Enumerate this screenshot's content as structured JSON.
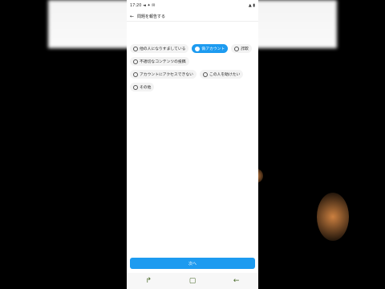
{
  "status_bar": {
    "time": "17:20",
    "left_icons": "◄ ✦ ✉",
    "right_icons": "▲ ▮"
  },
  "header": {
    "back_label": "←",
    "title": "問題を報告する"
  },
  "description": "",
  "options": [
    {
      "label": "他の人になりすましている",
      "selected": false
    },
    {
      "label": "偽アカウント",
      "selected": true
    },
    {
      "label": "詐欺",
      "selected": false
    },
    {
      "label": "不適切なコンテンツの投稿",
      "selected": false
    },
    {
      "label": "アカウントにアクセスできない",
      "selected": false
    },
    {
      "label": "この人を助けたい",
      "selected": false
    },
    {
      "label": "その他",
      "selected": false
    }
  ],
  "footer_note": "",
  "next_button": "次へ",
  "nav": {
    "recent": "↱",
    "home": "▢",
    "back": "←"
  },
  "colors": {
    "accent": "#1d9bf0",
    "page_bg": "#000000"
  }
}
